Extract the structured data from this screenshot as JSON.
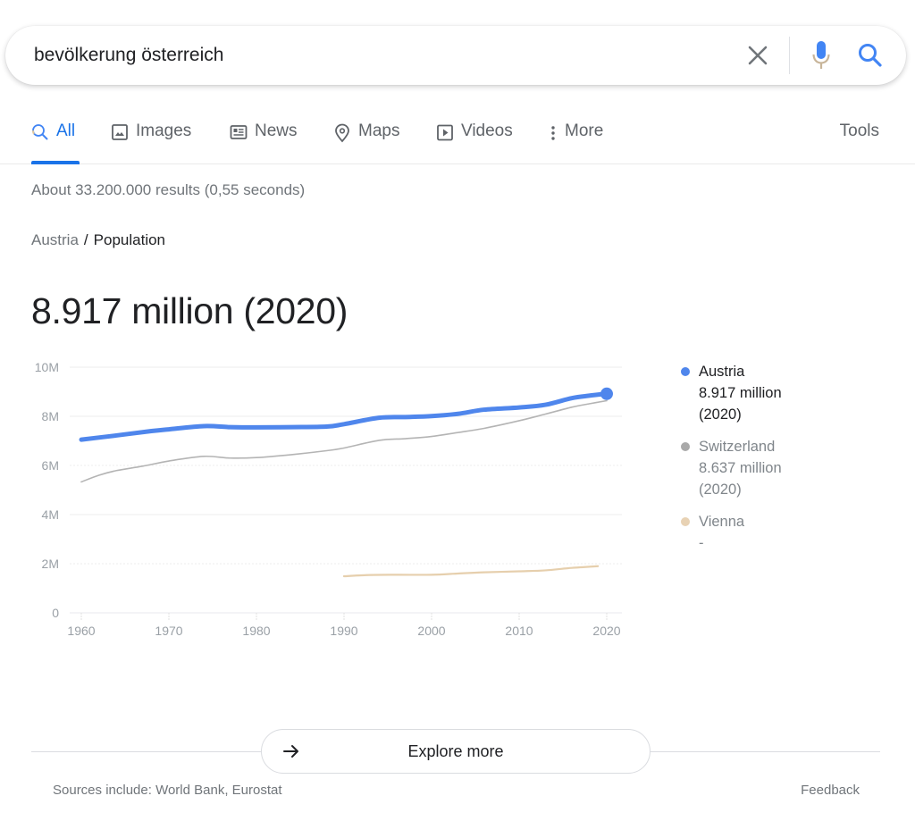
{
  "search": {
    "query": "bevölkerung österreich",
    "clear_icon": "close-icon",
    "mic_icon": "microphone-icon",
    "search_icon": "search-icon"
  },
  "tabs": [
    {
      "label": "All",
      "icon": "search-icon",
      "active": true
    },
    {
      "label": "Images",
      "icon": "image-icon",
      "active": false
    },
    {
      "label": "News",
      "icon": "news-icon",
      "active": false
    },
    {
      "label": "Maps",
      "icon": "map-pin-icon",
      "active": false
    },
    {
      "label": "Videos",
      "icon": "play-icon",
      "active": false
    },
    {
      "label": "More",
      "icon": "more-vert-icon",
      "active": false
    }
  ],
  "tools_label": "Tools",
  "result_stats": "About 33.200.000 results (0,55 seconds)",
  "breadcrumb": {
    "parent": "Austria",
    "separator": "/",
    "current": "Population"
  },
  "headline_value": "8.917 million (2020)",
  "legend": [
    {
      "name": "Austria",
      "value": "8.917 million",
      "year": "(2020)",
      "color": "#4f86ec",
      "selected": true
    },
    {
      "name": "Switzerland",
      "value": "8.637 million",
      "year": "(2020)",
      "color": "#a9a9a9",
      "selected": false
    },
    {
      "name": "Vienna",
      "value": "-",
      "year": "",
      "color": "#e8d2b4",
      "selected": false
    }
  ],
  "chart_data": {
    "type": "line",
    "title": "Population",
    "xlabel": "",
    "ylabel": "",
    "xlim": [
      1960,
      2020
    ],
    "ylim": [
      0,
      10000000
    ],
    "x_ticks": [
      1960,
      1970,
      1980,
      1990,
      2000,
      2010,
      2020
    ],
    "x_tick_labels": [
      "1960",
      "1970",
      "1980",
      "1990",
      "2000",
      "2010",
      "2020"
    ],
    "y_ticks": [
      0,
      2000000,
      4000000,
      6000000,
      8000000,
      10000000
    ],
    "y_tick_labels": [
      "0",
      "2M",
      "4M",
      "6M",
      "8M",
      "10M"
    ],
    "grid": true,
    "legend_position": "right",
    "series": [
      {
        "name": "Austria",
        "color": "#4f86ec",
        "emphasis": "bold",
        "end_marker": true,
        "x": [
          1960,
          1964,
          1968,
          1970,
          1974,
          1977,
          1980,
          1984,
          1988,
          1990,
          1994,
          1997,
          2000,
          2003,
          2006,
          2010,
          2013,
          2016,
          2018,
          2020
        ],
        "y": [
          7.05,
          7.22,
          7.4,
          7.47,
          7.6,
          7.56,
          7.55,
          7.56,
          7.58,
          7.68,
          7.94,
          7.97,
          8.01,
          8.1,
          8.27,
          8.36,
          8.47,
          8.74,
          8.84,
          8.917
        ]
      },
      {
        "name": "Switzerland",
        "color": "#b4b4b4",
        "x": [
          1960,
          1962,
          1964,
          1967,
          1970,
          1974,
          1977,
          1980,
          1984,
          1988,
          1990,
          1994,
          1997,
          2000,
          2003,
          2006,
          2010,
          2013,
          2016,
          2018,
          2020
        ],
        "y": [
          5.33,
          5.6,
          5.79,
          5.97,
          6.18,
          6.37,
          6.3,
          6.32,
          6.44,
          6.6,
          6.71,
          7.02,
          7.09,
          7.18,
          7.34,
          7.51,
          7.82,
          8.09,
          8.37,
          8.51,
          8.637
        ]
      },
      {
        "name": "Vienna",
        "color": "#e6cfad",
        "x": [
          1990,
          1993,
          1996,
          2000,
          2003,
          2006,
          2010,
          2013,
          2016,
          2019
        ],
        "y": [
          1.49,
          1.54,
          1.55,
          1.55,
          1.6,
          1.65,
          1.69,
          1.73,
          1.83,
          1.9
        ]
      }
    ],
    "y_unit": "million"
  },
  "explore_more": {
    "label": "Explore more",
    "icon": "arrow-right-icon"
  },
  "sources": "Sources include: World Bank, Eurostat",
  "feedback": "Feedback"
}
